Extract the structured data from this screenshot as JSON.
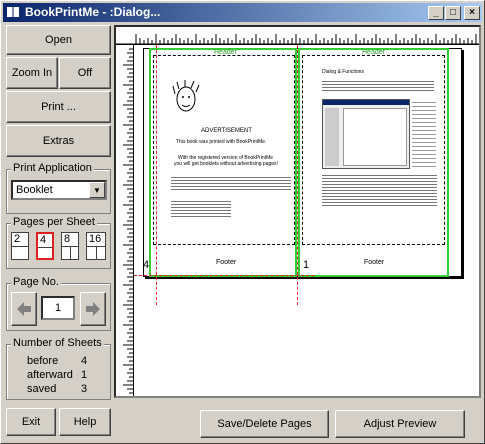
{
  "window": {
    "title": "BookPrintMe - :Dialog..."
  },
  "titlebar_buttons": {
    "minimize": "_",
    "maximize": "□",
    "close": "×"
  },
  "left": {
    "open": "Open",
    "zoom_in": "Zoom In",
    "off": "Off",
    "print": "Print ...",
    "extras": "Extras"
  },
  "print_application": {
    "legend": "Print Application",
    "value": "Booklet"
  },
  "pages_per_sheet": {
    "legend": "Pages per Sheet",
    "options": [
      "2",
      "4",
      "8",
      "16"
    ],
    "selected": "4"
  },
  "page_no": {
    "legend": "Page No.",
    "value": "1"
  },
  "sheets": {
    "legend": "Number of Sheets",
    "before_label": "before",
    "before_value": "4",
    "afterward_label": "afterward",
    "afterward_value": "1",
    "saved_label": "saved",
    "saved_value": "3"
  },
  "bottom": {
    "exit": "Exit",
    "help": "Help",
    "save_delete": "Save/Delete Pages",
    "adjust_preview": "Adjust Preview"
  },
  "preview": {
    "left_page": {
      "header": "Header",
      "footer": "Footer",
      "number": "4",
      "advert": "ADVERTISEMENT",
      "line1": "This book was printed with BookPrintMe.",
      "line2": "With the registered version of BookPrintMe",
      "line3": "you will get booklets without advertising pages!"
    },
    "right_page": {
      "header": "Header",
      "footer": "Footer",
      "number": "1",
      "section_title": "Dialog & Functions"
    }
  }
}
